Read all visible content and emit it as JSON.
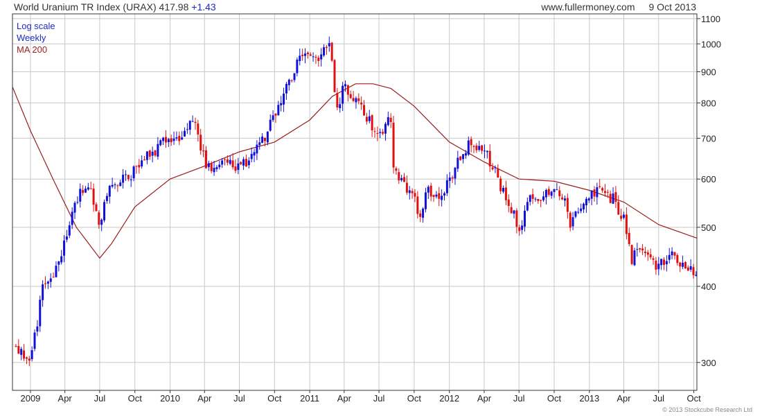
{
  "header": {
    "title": "World Uranium TR Index (URAX)",
    "last": "417.98",
    "change": "+1.43",
    "site": "www.fullermoney.com",
    "date": "9 Oct 2013"
  },
  "legend": {
    "items": [
      "Log scale",
      "Weekly",
      "MA 200"
    ],
    "colors": [
      "#1a2ac8",
      "#1a2ac8",
      "#a02020"
    ]
  },
  "footer": {
    "copyright": "© 2013 Stockcube Research Ltd"
  },
  "colors": {
    "up": "#1010d8",
    "down": "#e01010",
    "ma": "#9b1c1c",
    "grid": "#c8c8c8"
  },
  "chart_data": {
    "type": "candlestick",
    "scale": "log",
    "grid": true,
    "ylim": [
      270,
      1120
    ],
    "xlim": [
      "2008-11-15",
      "2013-10-09"
    ],
    "yticks": [
      300,
      400,
      500,
      600,
      700,
      800,
      900,
      1000,
      1100
    ],
    "xticks": [
      {
        "label": "2009",
        "date": "2009-01-01"
      },
      {
        "label": "Apr",
        "date": "2009-04-01"
      },
      {
        "label": "Jul",
        "date": "2009-07-01"
      },
      {
        "label": "Oct",
        "date": "2009-10-01"
      },
      {
        "label": "2010",
        "date": "2010-01-01"
      },
      {
        "label": "Apr",
        "date": "2010-04-01"
      },
      {
        "label": "Jul",
        "date": "2010-07-01"
      },
      {
        "label": "Oct",
        "date": "2010-10-01"
      },
      {
        "label": "2011",
        "date": "2011-01-01"
      },
      {
        "label": "Apr",
        "date": "2011-04-01"
      },
      {
        "label": "Jul",
        "date": "2011-07-01"
      },
      {
        "label": "Oct",
        "date": "2011-10-01"
      },
      {
        "label": "2012",
        "date": "2012-01-01"
      },
      {
        "label": "Apr",
        "date": "2012-04-01"
      },
      {
        "label": "Jul",
        "date": "2012-07-01"
      },
      {
        "label": "Oct",
        "date": "2012-10-01"
      },
      {
        "label": "2013",
        "date": "2013-01-01"
      },
      {
        "label": "Apr",
        "date": "2013-04-01"
      },
      {
        "label": "Jul",
        "date": "2013-07-01"
      },
      {
        "label": "Oct",
        "date": "2013-10-01"
      }
    ],
    "series": [
      {
        "name": "URAX weekly close",
        "x": [
          "2008-11-24",
          "2009-01-01",
          "2009-02-01",
          "2009-03-01",
          "2009-04-01",
          "2009-05-01",
          "2009-06-01",
          "2009-07-01",
          "2009-08-01",
          "2009-09-01",
          "2009-10-01",
          "2009-11-01",
          "2009-12-01",
          "2010-01-01",
          "2010-02-01",
          "2010-03-01",
          "2010-04-01",
          "2010-05-01",
          "2010-06-01",
          "2010-07-01",
          "2010-08-01",
          "2010-09-01",
          "2010-10-01",
          "2010-11-01",
          "2010-12-01",
          "2011-01-01",
          "2011-02-01",
          "2011-02-20",
          "2011-03-14",
          "2011-04-01",
          "2011-05-01",
          "2011-06-01",
          "2011-07-01",
          "2011-08-01",
          "2011-08-10",
          "2011-09-01",
          "2011-10-01",
          "2011-10-15",
          "2011-11-01",
          "2011-12-01",
          "2012-01-01",
          "2012-02-01",
          "2012-03-01",
          "2012-04-01",
          "2012-05-01",
          "2012-06-01",
          "2012-07-01",
          "2012-08-01",
          "2012-09-01",
          "2012-10-01",
          "2012-11-01",
          "2012-11-15",
          "2012-12-01",
          "2013-01-01",
          "2013-02-01",
          "2013-03-01",
          "2013-04-01",
          "2013-04-20",
          "2013-05-01",
          "2013-06-01",
          "2013-07-01",
          "2013-08-01",
          "2013-09-01",
          "2013-10-09"
        ],
        "values": [
          320,
          300,
          395,
          415,
          470,
          560,
          590,
          510,
          590,
          600,
          620,
          650,
          680,
          700,
          690,
          760,
          640,
          610,
          650,
          620,
          660,
          700,
          760,
          860,
          930,
          950,
          960,
          1030,
          780,
          850,
          800,
          760,
          700,
          760,
          610,
          585,
          560,
          500,
          590,
          550,
          600,
          660,
          690,
          670,
          610,
          550,
          500,
          560,
          560,
          590,
          540,
          500,
          540,
          570,
          570,
          560,
          520,
          440,
          460,
          450,
          430,
          450,
          440,
          417.98
        ]
      },
      {
        "name": "MA 200",
        "x": [
          "2008-11-15",
          "2009-01-01",
          "2009-03-01",
          "2009-05-01",
          "2009-07-01",
          "2009-08-01",
          "2009-10-01",
          "2010-01-01",
          "2010-04-01",
          "2010-07-01",
          "2010-10-01",
          "2011-01-01",
          "2011-03-01",
          "2011-05-01",
          "2011-06-15",
          "2011-08-01",
          "2011-10-01",
          "2012-01-01",
          "2012-04-01",
          "2012-07-01",
          "2012-10-01",
          "2013-01-01",
          "2013-04-01",
          "2013-07-01",
          "2013-10-09"
        ],
        "values": [
          850,
          720,
          600,
          500,
          445,
          470,
          540,
          600,
          630,
          665,
          690,
          750,
          820,
          860,
          860,
          845,
          790,
          690,
          640,
          600,
          595,
          575,
          550,
          505,
          480
        ]
      }
    ]
  }
}
